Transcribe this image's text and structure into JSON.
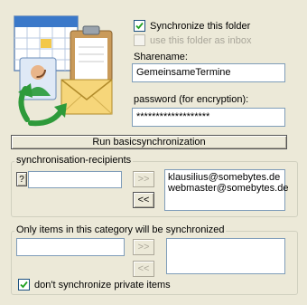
{
  "sync": {
    "synchronize_label": "Synchronize this folder",
    "synchronize_checked": true,
    "use_inbox_label": "use this folder as inbox",
    "use_inbox_checked": false
  },
  "sharename": {
    "label": "Sharename:",
    "value": "GemeinsameTermine"
  },
  "password": {
    "label": "password (for encryption):",
    "value": "*******************"
  },
  "run_button": "Run basicsynchronization",
  "recipients": {
    "legend": "synchronisation-recipients",
    "help_button": "?",
    "input_value": "",
    "add_button": ">>",
    "remove_button": "<<",
    "items": [
      "klausilius@somebytes.de",
      "webmaster@somebytes.de"
    ]
  },
  "category": {
    "legend": "Only items in this category will be synchronized",
    "input_value": "",
    "add_button": ">>",
    "remove_button": "<<",
    "items": []
  },
  "private": {
    "label": "don't synchronize private items",
    "checked": true
  }
}
